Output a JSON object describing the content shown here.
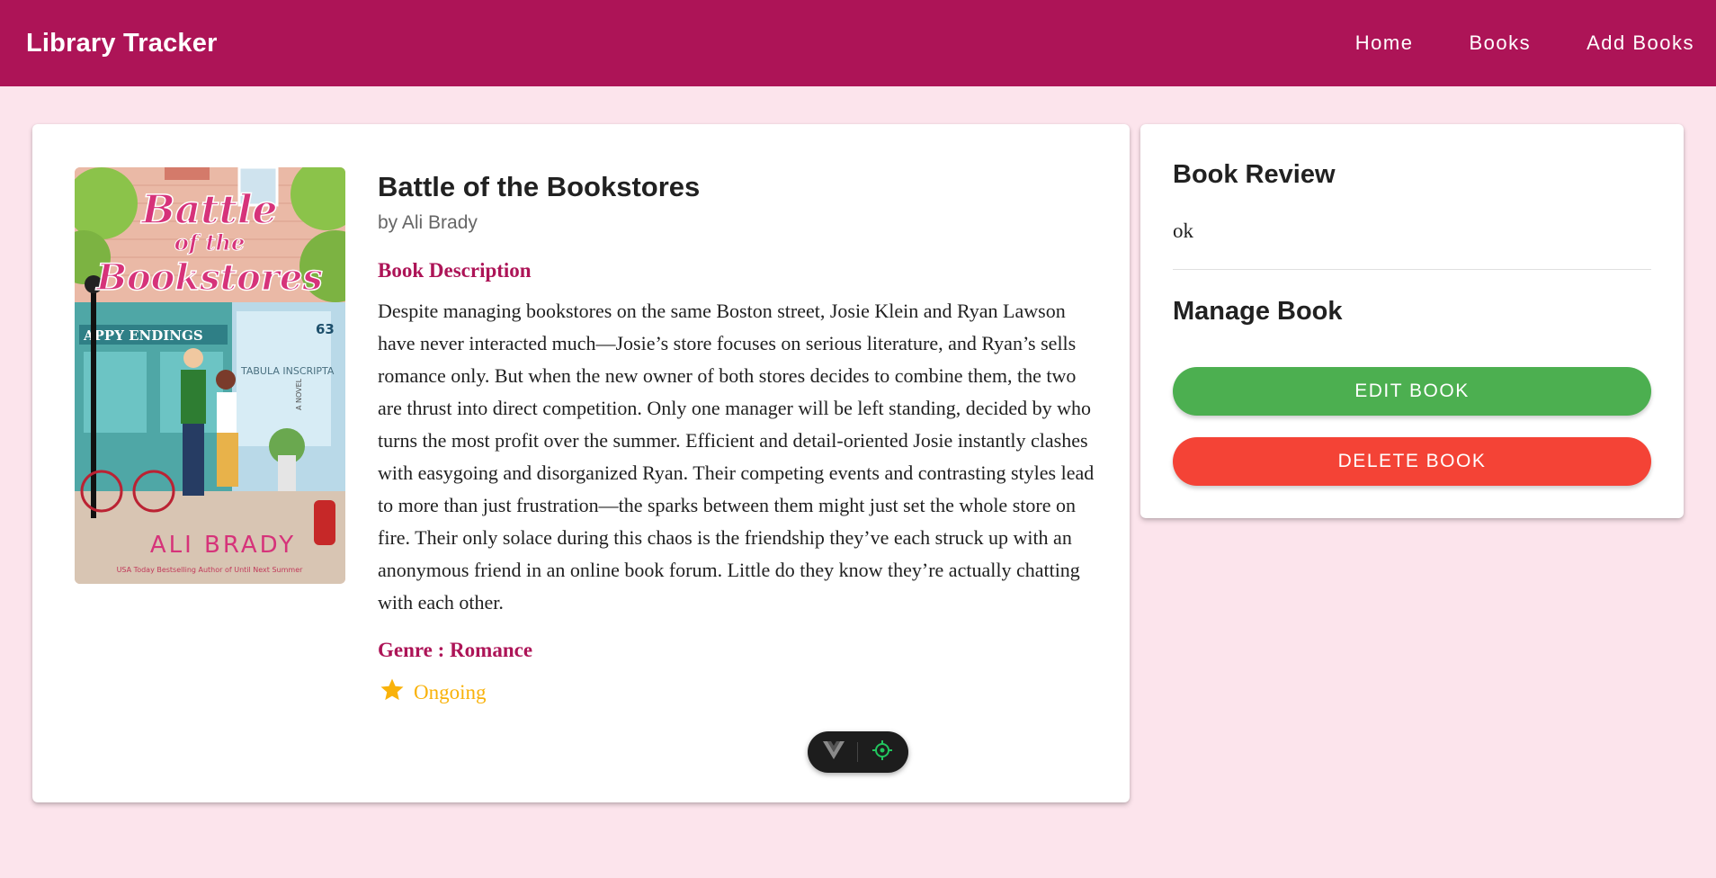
{
  "app": {
    "title": "Library Tracker"
  },
  "nav": {
    "items": [
      {
        "label": "Home"
      },
      {
        "label": "Books"
      },
      {
        "label": "Add Books"
      }
    ]
  },
  "book": {
    "title": "Battle of the Bookstores",
    "author": "by Ali Brady",
    "description_label": "Book Description",
    "description": "Despite managing bookstores on the same Boston street, Josie Klein and Ryan Lawson have never interacted much—Josie’s store focuses on serious literature, and Ryan’s sells romance only. But when the new owner of both stores decides to combine them, the two are thrust into direct competition. Only one manager will be left standing, decided by who turns the most profit over the summer. Efficient and detail-oriented Josie instantly clashes with easygoing and disorganized Ryan. Their competing events and contrasting styles lead to more than just frustration—the sparks between them might just set the whole store on fire. Their only solace during this chaos is the friendship they’ve each struck up with an anonymous friend in an online book forum. Little do they know they’re actually chatting with each other.",
    "genre": "Genre : Romance",
    "status": "Ongoing",
    "status_icon": "star-icon",
    "cover": {
      "title_line1": "Battle",
      "title_line2": "of the",
      "title_line3": "Bookstores",
      "author": "ALI BRADY",
      "tagline": "USA Today Bestselling Author of Until Next Summer",
      "storefront_sign": "APPY ENDINGS",
      "shop_sign": "TABULA INSCRIPTA",
      "street_number": "63",
      "novel_label": "A NOVEL"
    }
  },
  "review": {
    "heading": "Book Review",
    "text": "ok"
  },
  "manage": {
    "heading": "Manage Book",
    "edit_label": "EDIT BOOK",
    "delete_label": "DELETE BOOK"
  },
  "colors": {
    "primary": "#ad1457",
    "page_bg": "#fce4ec",
    "edit": "#4caf50",
    "delete": "#f44336",
    "star": "#f9b20a"
  },
  "devtools": {
    "icons": [
      "vue-logo-icon",
      "target-icon"
    ]
  }
}
